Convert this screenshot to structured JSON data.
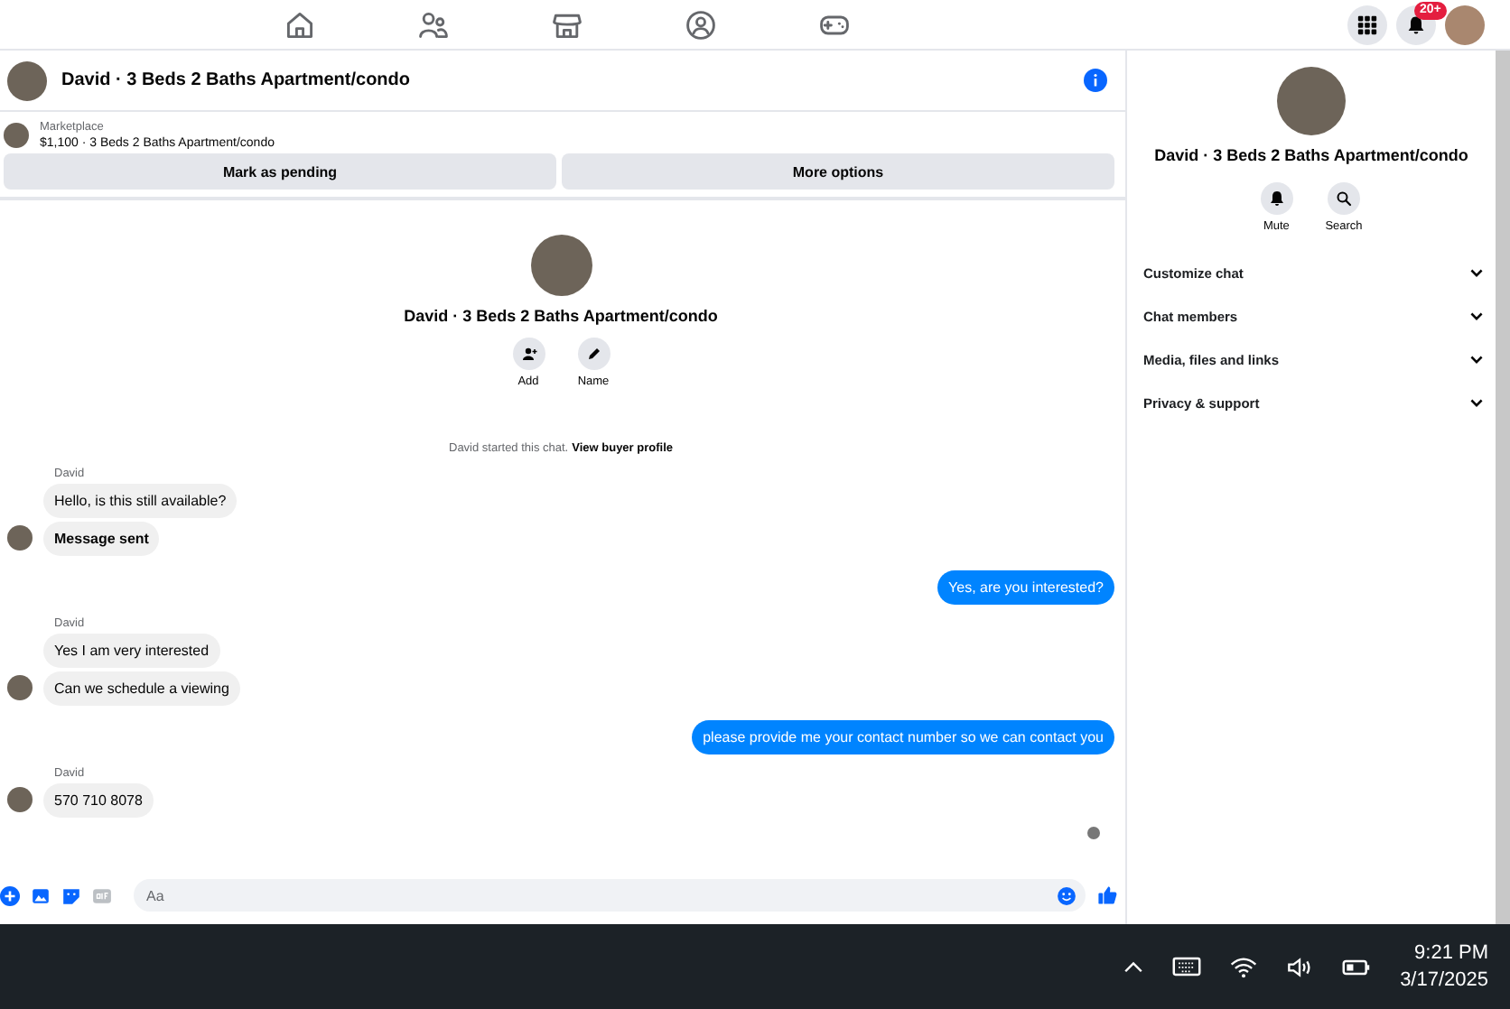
{
  "top_nav": {
    "notification_badge": "20+"
  },
  "chat": {
    "title": "David · 3 Beds 2 Baths Apartment/condo",
    "listing": {
      "label": "Marketplace",
      "summary": "$1,100 · 3 Beds 2 Baths Apartment/condo"
    },
    "actions": [
      "Mark as pending",
      "More options"
    ],
    "profile": {
      "title": "David · 3 Beds 2 Baths Apartment/condo",
      "buttons": [
        {
          "kind": "add",
          "label": "Add"
        },
        {
          "kind": "name",
          "label": "Name"
        }
      ]
    },
    "intro": {
      "text": "David started this chat.",
      "link": "View buyer profile"
    },
    "groups": [
      {
        "kind": "incoming",
        "sender": "David",
        "messages": [
          {
            "text": "Hello, is this still available?",
            "bold": false
          },
          {
            "text": "Message sent",
            "bold": true
          }
        ]
      },
      {
        "kind": "outgoing",
        "messages": [
          {
            "text": "Yes, are you interested?",
            "bold": false
          }
        ]
      },
      {
        "kind": "incoming",
        "sender": "David",
        "messages": [
          {
            "text": "Yes I am very interested",
            "bold": false
          },
          {
            "text": "Can we schedule a viewing",
            "bold": false
          }
        ]
      },
      {
        "kind": "outgoing",
        "messages": [
          {
            "text": "please provide me your contact number so we can contact you",
            "bold": false
          }
        ]
      },
      {
        "kind": "incoming",
        "sender": "David",
        "messages": [
          {
            "text": "570 710 8078",
            "bold": false
          }
        ]
      }
    ],
    "seen": true,
    "composer": {
      "placeholder": "Aa"
    }
  },
  "details": {
    "title": "David · 3 Beds 2 Baths Apartment/condo",
    "buttons": [
      {
        "kind": "mute",
        "label": "Mute"
      },
      {
        "kind": "search",
        "label": "Search"
      }
    ],
    "sections": [
      {
        "label": "Customize chat",
        "expanded": false
      },
      {
        "label": "Chat members",
        "expanded": false
      },
      {
        "label": "Media, files and links",
        "expanded": false
      },
      {
        "label": "Privacy & support",
        "expanded": false
      }
    ]
  },
  "taskbar": {
    "time": "9:21 PM",
    "date": "3/17/2025"
  }
}
